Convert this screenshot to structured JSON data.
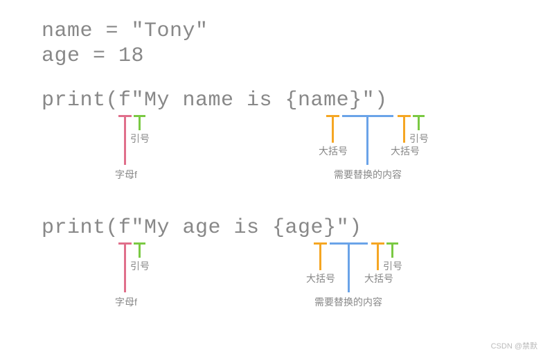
{
  "code": {
    "line1": "name = \"Tony\"",
    "line2": "age = 18",
    "line3": "print(f\"My name is {name}\")",
    "line4": "print(f\"My age is {age}\")"
  },
  "annotations": {
    "letter_f": "字母f",
    "quote": "引号",
    "brace": "大括号",
    "content": "需要替换的内容"
  },
  "colors": {
    "f": "#e06f8b",
    "quote": "#7ac943",
    "brace": "#f5a623",
    "content": "#6aa3e8"
  },
  "watermark": "CSDN @禁默"
}
